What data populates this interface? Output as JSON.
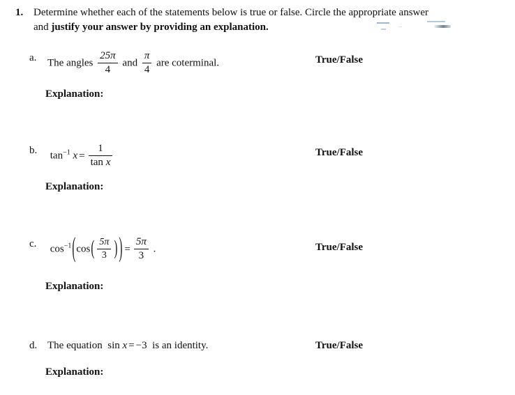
{
  "document": {
    "background_color": "#ffffff",
    "text_color": "#111111"
  },
  "question": {
    "number": "1.",
    "prompt_part1": "Determine whether each of the statements below is true or false.  Circle the appropriate answer and ",
    "prompt_bold": "justify your answer by providing an explanation."
  },
  "items": [
    {
      "letter": "a.",
      "statement_lead": "The angles ",
      "fraction1": {
        "numerator": "25π",
        "denominator": "4"
      },
      "statement_mid": "and",
      "fraction2": {
        "numerator": "π",
        "denominator": "4"
      },
      "statement_tail": "are coterminal.",
      "answer_label": "True/False",
      "explanation_label": "Explanation:"
    },
    {
      "letter": "b.",
      "function_name": "tan",
      "exponent": "−1",
      "variable": "x",
      "equals": "=",
      "fraction1": {
        "numerator": "1",
        "denominator_func": "tan",
        "denominator_var": "x"
      },
      "answer_label": "True/False",
      "explanation_label": "Explanation:"
    },
    {
      "letter": "c.",
      "outer_function": "cos",
      "outer_exponent": "−1",
      "inner_function": "cos",
      "inner_fraction": {
        "numerator": "5π",
        "denominator": "3"
      },
      "equals": "=",
      "result_fraction": {
        "numerator": "5π",
        "denominator": "3"
      },
      "trailing_period": ".",
      "answer_label": "True/False",
      "explanation_label": "Explanation:"
    },
    {
      "letter": "d.",
      "statement_lead": "The equation",
      "function_name": "sin",
      "variable": "x",
      "equals": "=",
      "value": "−3",
      "statement_tail": "is an identity.",
      "answer_label": "True/False",
      "explanation_label": "Explanation:"
    }
  ]
}
